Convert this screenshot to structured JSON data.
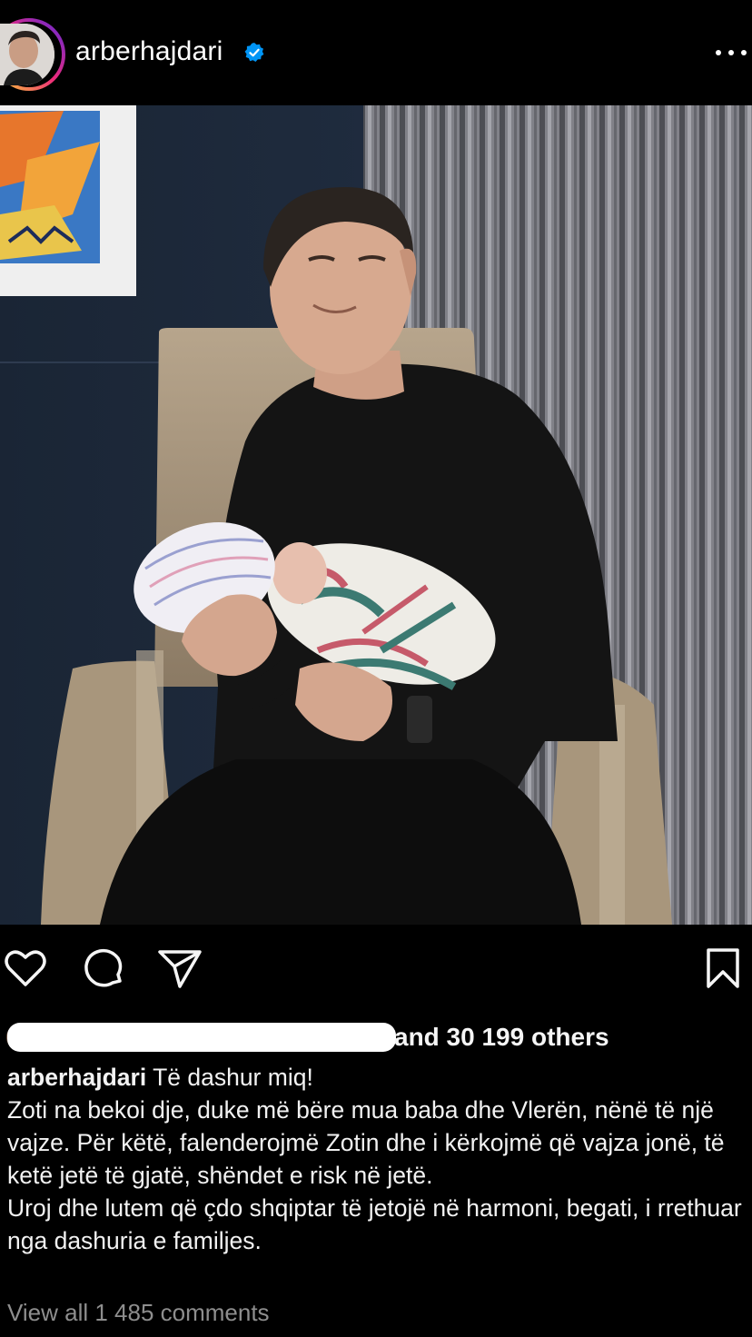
{
  "post": {
    "username": "arberhajdari",
    "verified_icon": "verified-badge-icon",
    "more_icon": "more-options-icon"
  },
  "actions": {
    "like_icon": "heart-icon",
    "comment_icon": "comment-icon",
    "share_icon": "send-icon",
    "save_icon": "bookmark-icon"
  },
  "likes": {
    "text": "and 30 199 others"
  },
  "caption": {
    "username": "arberhajdari",
    "first_line": " Të dashur miq!",
    "paragraph_1": "Zoti na bekoi dje, duke më bëre mua baba dhe Vlerën, nënë të një vajze. Për këtë, falenderojmë Zotin dhe i kërkojmë që vajza jonë, të ketë jetë të gjatë, shëndet e risk në jetë.",
    "paragraph_2": "Uroj dhe lutem që çdo shqiptar të jetojë në harmoni, begati, i rrethuar nga dashuria e familjes."
  },
  "comments": {
    "link_text": "View all 1 485 comments"
  },
  "colors": {
    "background": "#000000",
    "text": "#f5f5f5",
    "muted": "#8e8e8e",
    "verified": "#0095f6"
  }
}
